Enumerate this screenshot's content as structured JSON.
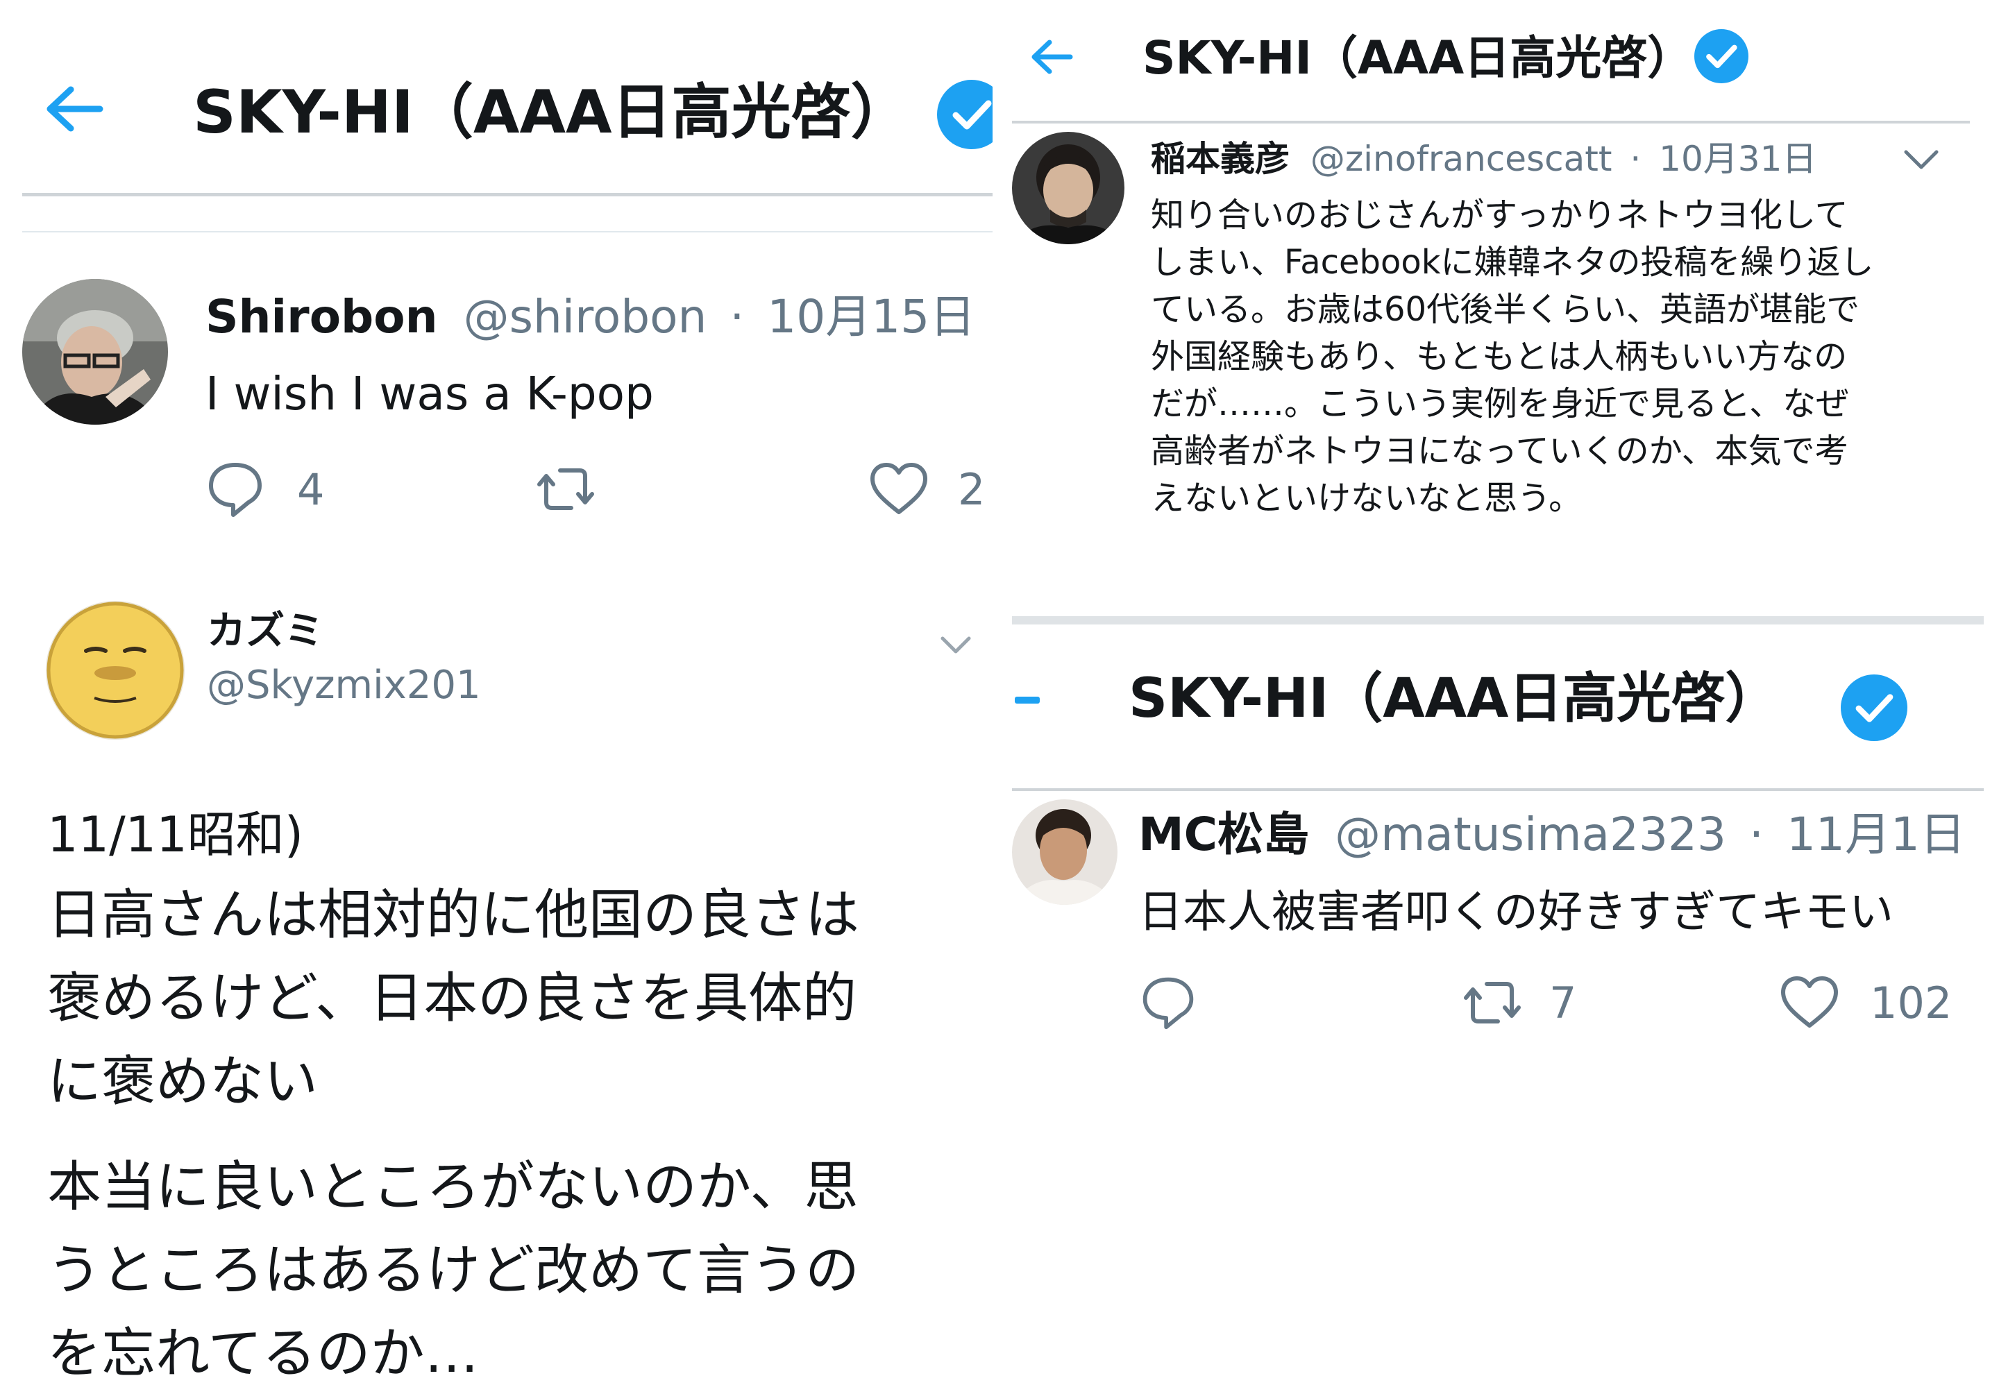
{
  "panel_tl": {
    "header": {
      "title": "SKY-HI（AAA日高光啓）"
    },
    "tweet": {
      "display_name": "Shirobon",
      "handle": "@shirobon",
      "separator": "·",
      "date": "10月15日",
      "text": "I wish I was a K-pop",
      "reply_count": "4",
      "like_count": "2"
    }
  },
  "panel_bl": {
    "display_name": "カズミ",
    "handle": "@Skyzmix201",
    "body_lines": [
      "11/11昭和)",
      "日高さんは相対的に他国の良さは",
      "褒めるけど、日本の良さを具体的",
      "に褒めない",
      "本当に良いところがないのか、思",
      "うところはあるけど改めて言うの",
      "を忘れてるのか…"
    ]
  },
  "panel_tr": {
    "header": {
      "title": "SKY-HI（AAA日高光啓）"
    },
    "tweet": {
      "display_name": "稲本義彦",
      "handle": "@zinofrancescatt",
      "separator": "·",
      "date": "10月31日",
      "body_lines": [
        "知り合いのおじさんがすっかりネトウヨ化して",
        "しまい、Facebookに嫌韓ネタの投稿を繰り返し",
        "ている。お歳は60代後半くらい、英語が堪能で",
        "外国経験もあり、もともとは人柄もいい方なの",
        "だが……。こういう実例を身近で見ると、なぜ",
        "高齢者がネトウヨになっていくのか、本気で考",
        "えないといけないなと思う。"
      ]
    }
  },
  "panel_br": {
    "header": {
      "title": "SKY-HI（AAA日高光啓）"
    },
    "tweet": {
      "display_name": "MC松島",
      "handle": "@matusima2323",
      "separator": "·",
      "date": "11月1日",
      "text": "日本人被害者叩くの好きすぎてキモい",
      "retweet_count": "7",
      "like_count": "102"
    }
  },
  "icons": {
    "back": "arrow-left-icon",
    "verified": "verified-badge-icon",
    "reply": "reply-icon",
    "retweet": "retweet-icon",
    "like": "heart-icon",
    "more": "chevron-down-icon"
  },
  "colors": {
    "accent": "#1da1f2",
    "text": "#14171a",
    "secondary_text": "#657786",
    "divider": "#cfd4d8"
  }
}
